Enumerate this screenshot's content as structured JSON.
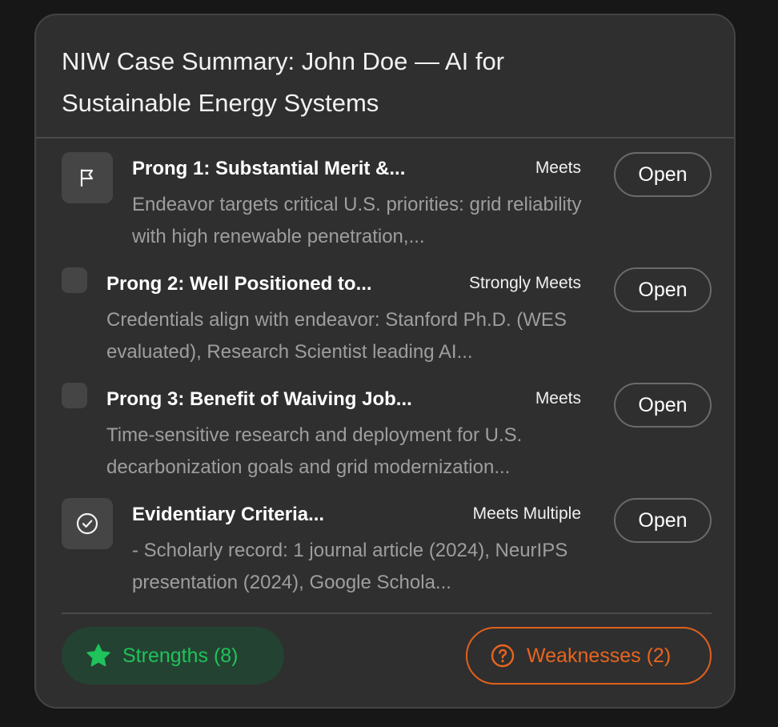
{
  "card": {
    "title": "NIW Case Summary: John Doe — AI for Sustainable Energy Systems"
  },
  "criteria": [
    {
      "icon": "flag-icon",
      "title": "Prong 1: Substantial Merit &...",
      "status": "Meets",
      "description": "Endeavor targets critical U.S. priorities: grid reliability with high renewable penetration,...",
      "action_label": "Open"
    },
    {
      "icon": "none",
      "title": "Prong 2: Well Positioned to...",
      "status": "Strongly Meets",
      "description": "Credentials align with endeavor: Stanford Ph.D. (WES evaluated), Research Scientist leading AI...",
      "action_label": "Open"
    },
    {
      "icon": "none",
      "title": "Prong 3: Benefit of Waiving Job...",
      "status": "Meets",
      "description": "Time-sensitive research and deployment for U.S. decarbonization goals and grid modernization...",
      "action_label": "Open"
    },
    {
      "icon": "check-circle-icon",
      "title": "Evidentiary Criteria...",
      "status": "Meets Multiple",
      "description": "- Scholarly record: 1 journal article (2024), NeurIPS presentation (2024), Google Schola...",
      "action_label": "Open"
    }
  ],
  "footer": {
    "strengths_label": "Strengths (8)",
    "strengths_icon": "star-icon",
    "weaknesses_label": "Weaknesses (2)",
    "weaknesses_icon": "question-circle-icon"
  },
  "colors": {
    "background": "#171717",
    "card": "#2f2f2f",
    "strengths_text": "#1fc25b",
    "strengths_bg": "#244231",
    "weaknesses_accent": "#e8651f"
  }
}
